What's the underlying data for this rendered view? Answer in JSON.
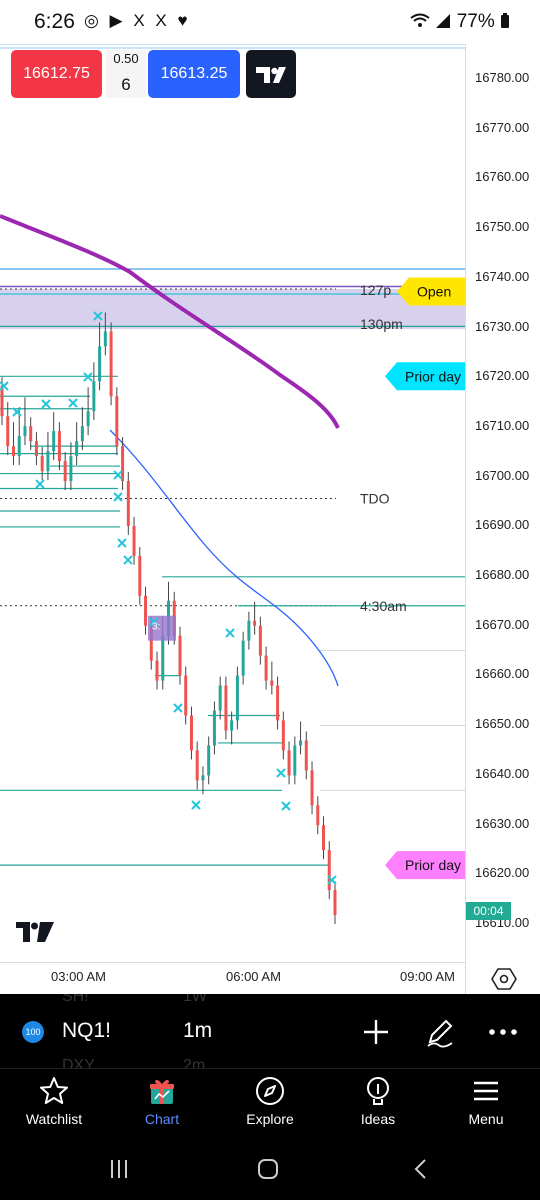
{
  "status_bar": {
    "time": "6:26",
    "notification_icons": "◎ ▶ X X ♥",
    "indicators": "📶 77%",
    "battery_percent": "77%"
  },
  "trade": {
    "sell_price": "16612.75",
    "buy_price": "16613.25",
    "spread": "0.50",
    "quantity": "6"
  },
  "price_axis": {
    "labels": [
      "16780.00",
      "16770.00",
      "16760.00",
      "16750.00",
      "16740.00",
      "16730.00",
      "16720.00",
      "16710.00",
      "16700.00",
      "16690.00",
      "16680.00",
      "16670.00",
      "16660.00",
      "16650.00",
      "16640.00",
      "16630.00",
      "16620.00",
      "16610.00"
    ],
    "countdown": "00:04"
  },
  "time_axis": {
    "labels": [
      "03:00 AM",
      "06:00 AM",
      "09:00 AM"
    ]
  },
  "chart_data": {
    "type": "candlestick",
    "symbol": "NQ1!",
    "interval": "1m",
    "ylim": [
      16606,
      16787
    ],
    "grid": false,
    "annotations": [
      {
        "text": "127p",
        "price": 16737.5
      },
      {
        "text": "130pm",
        "price": 16730.5
      },
      {
        "text": "TDO",
        "price": 16695.5
      },
      {
        "text": "4:30am",
        "price": 16674
      },
      {
        "text": "3:",
        "price": 16670
      }
    ],
    "flags": [
      {
        "text": "Open",
        "price": 16737,
        "color": "#ffe600"
      },
      {
        "text": "Prior day",
        "price": 16720,
        "color": "#00e5ff"
      },
      {
        "text": "Prior day",
        "price": 16622,
        "color": "#ff80ff"
      }
    ],
    "close_path": [
      [
        16718,
        16712
      ],
      [
        16713,
        16706
      ],
      [
        16709,
        16704
      ],
      [
        16712,
        16708
      ],
      [
        16714,
        16710
      ],
      [
        16710,
        16707
      ],
      [
        16706,
        16704
      ],
      [
        16703,
        16701
      ],
      [
        16707,
        16705
      ],
      [
        16711,
        16709
      ],
      [
        16706,
        16703
      ],
      [
        16701,
        16699
      ],
      [
        16705,
        16704
      ],
      [
        16709,
        16707
      ],
      [
        16712,
        16710
      ],
      [
        16716,
        16713
      ],
      [
        16721,
        16719
      ],
      [
        16729,
        16726
      ],
      [
        16731,
        16729
      ],
      [
        16719,
        16716
      ],
      [
        16711,
        16706
      ],
      [
        16703,
        16699
      ],
      [
        16694,
        16690
      ],
      [
        16688,
        16684
      ],
      [
        16680,
        16676
      ],
      [
        16673,
        16670
      ],
      [
        16666,
        16663
      ],
      [
        16662,
        16659
      ],
      [
        16670,
        16668
      ],
      [
        16677,
        16675
      ],
      [
        16672,
        16668
      ],
      [
        16664,
        16660
      ],
      [
        16655,
        16652
      ],
      [
        16648,
        16645
      ],
      [
        16642,
        16639
      ],
      [
        16638,
        16640
      ],
      [
        16644,
        16646
      ],
      [
        16651,
        16653
      ],
      [
        16656,
        16658
      ],
      [
        16652,
        16649
      ],
      [
        16648,
        16651
      ],
      [
        16657,
        16660
      ],
      [
        16664,
        16667
      ],
      [
        16669,
        16671
      ],
      [
        16673,
        16670
      ],
      [
        16667,
        16664
      ],
      [
        16662,
        16659
      ],
      [
        16661,
        16658
      ],
      [
        16654,
        16651
      ],
      [
        16648,
        16645
      ],
      [
        16642,
        16640
      ],
      [
        16643,
        16646
      ],
      [
        16649,
        16647
      ],
      [
        16644,
        16641
      ],
      [
        16637,
        16634
      ],
      [
        16633,
        16630
      ],
      [
        16628,
        16625
      ],
      [
        16621,
        16617
      ],
      [
        16615,
        16612
      ]
    ]
  },
  "toolbar": {
    "symbol_badge": "100",
    "symbol": "NQ1!",
    "interval": "1m",
    "ghost_symbol_top": "SH!",
    "ghost_interval_top": "1W",
    "ghost_symbol_bottom": "DXY",
    "ghost_interval_bottom": "2m"
  },
  "nav": {
    "items": [
      {
        "label": "Watchlist",
        "active": false
      },
      {
        "label": "Chart",
        "active": true
      },
      {
        "label": "Explore",
        "active": false
      },
      {
        "label": "Ideas",
        "active": false
      },
      {
        "label": "Menu",
        "active": false
      }
    ]
  },
  "colors": {
    "sell": "#f23645",
    "buy": "#2962ff",
    "teal_lines": "#26a69a",
    "ma_purple": "#9c27b0",
    "ma_blue": "#2962ff",
    "marker": "#26c6da"
  }
}
